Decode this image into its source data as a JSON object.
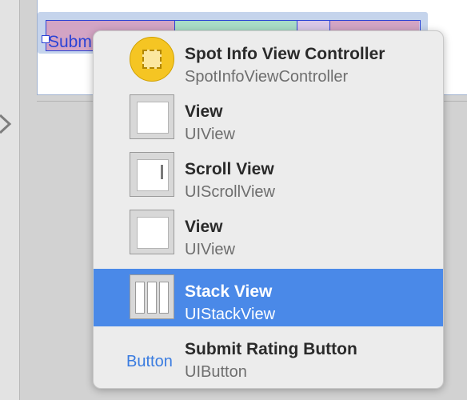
{
  "canvas": {
    "button_fragment": "Subm"
  },
  "menu": {
    "items": [
      {
        "title": "Spot Info View Controller",
        "subtitle": "SpotInfoViewController",
        "icon": "view-controller-icon",
        "selected": false
      },
      {
        "title": "View",
        "subtitle": "UIView",
        "icon": "view-icon",
        "selected": false
      },
      {
        "title": "Scroll View",
        "subtitle": "UIScrollView",
        "icon": "scroll-view-icon",
        "selected": false
      },
      {
        "title": "View",
        "subtitle": "UIView",
        "icon": "view-icon",
        "selected": false
      },
      {
        "title": "Stack View",
        "subtitle": "UIStackView",
        "icon": "stack-view-icon",
        "selected": true
      },
      {
        "title": "Submit Rating Button",
        "subtitle": "UIButton",
        "icon": "button-icon",
        "icon_label": "Button",
        "selected": false
      }
    ]
  },
  "colors": {
    "selection": "#4a89e8",
    "button_label": "#3a7ce0",
    "stack_border": "#2b43d6",
    "view_controller": "#f5c523"
  }
}
